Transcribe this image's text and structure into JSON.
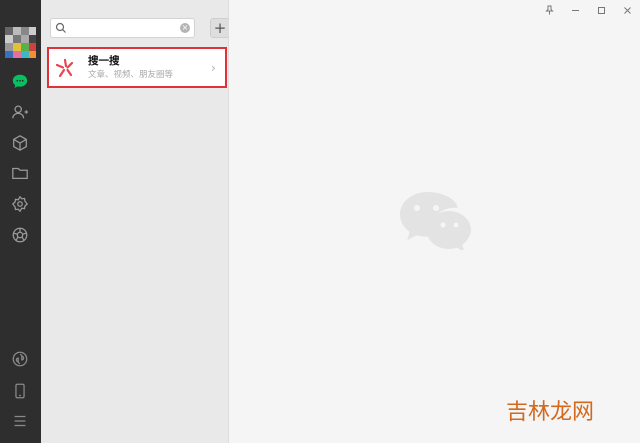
{
  "nav": {
    "items": [
      {
        "icon": "chat-icon",
        "active": true
      },
      {
        "icon": "contacts-icon",
        "active": false
      },
      {
        "icon": "box-icon",
        "active": false
      },
      {
        "icon": "folder-icon",
        "active": false
      },
      {
        "icon": "settings-icon",
        "active": false
      },
      {
        "icon": "moments-icon",
        "active": false
      }
    ],
    "bottom_items": [
      {
        "icon": "miniprogram-icon"
      },
      {
        "icon": "phone-icon"
      },
      {
        "icon": "menu-icon"
      }
    ],
    "accent": "#07c160"
  },
  "search": {
    "placeholder": "",
    "value": "",
    "clear_label": "×",
    "add_label": "+"
  },
  "sou": {
    "title": "搜一搜",
    "subtitle": "文章、视频、朋友圈等",
    "chevron": "›",
    "highlight_color": "#e0303a"
  },
  "window": {
    "pin_label": "⚲",
    "minimize_label": "—",
    "maximize_label": "☐",
    "close_label": "✕"
  },
  "watermark": {
    "text": "吉林龙网"
  }
}
